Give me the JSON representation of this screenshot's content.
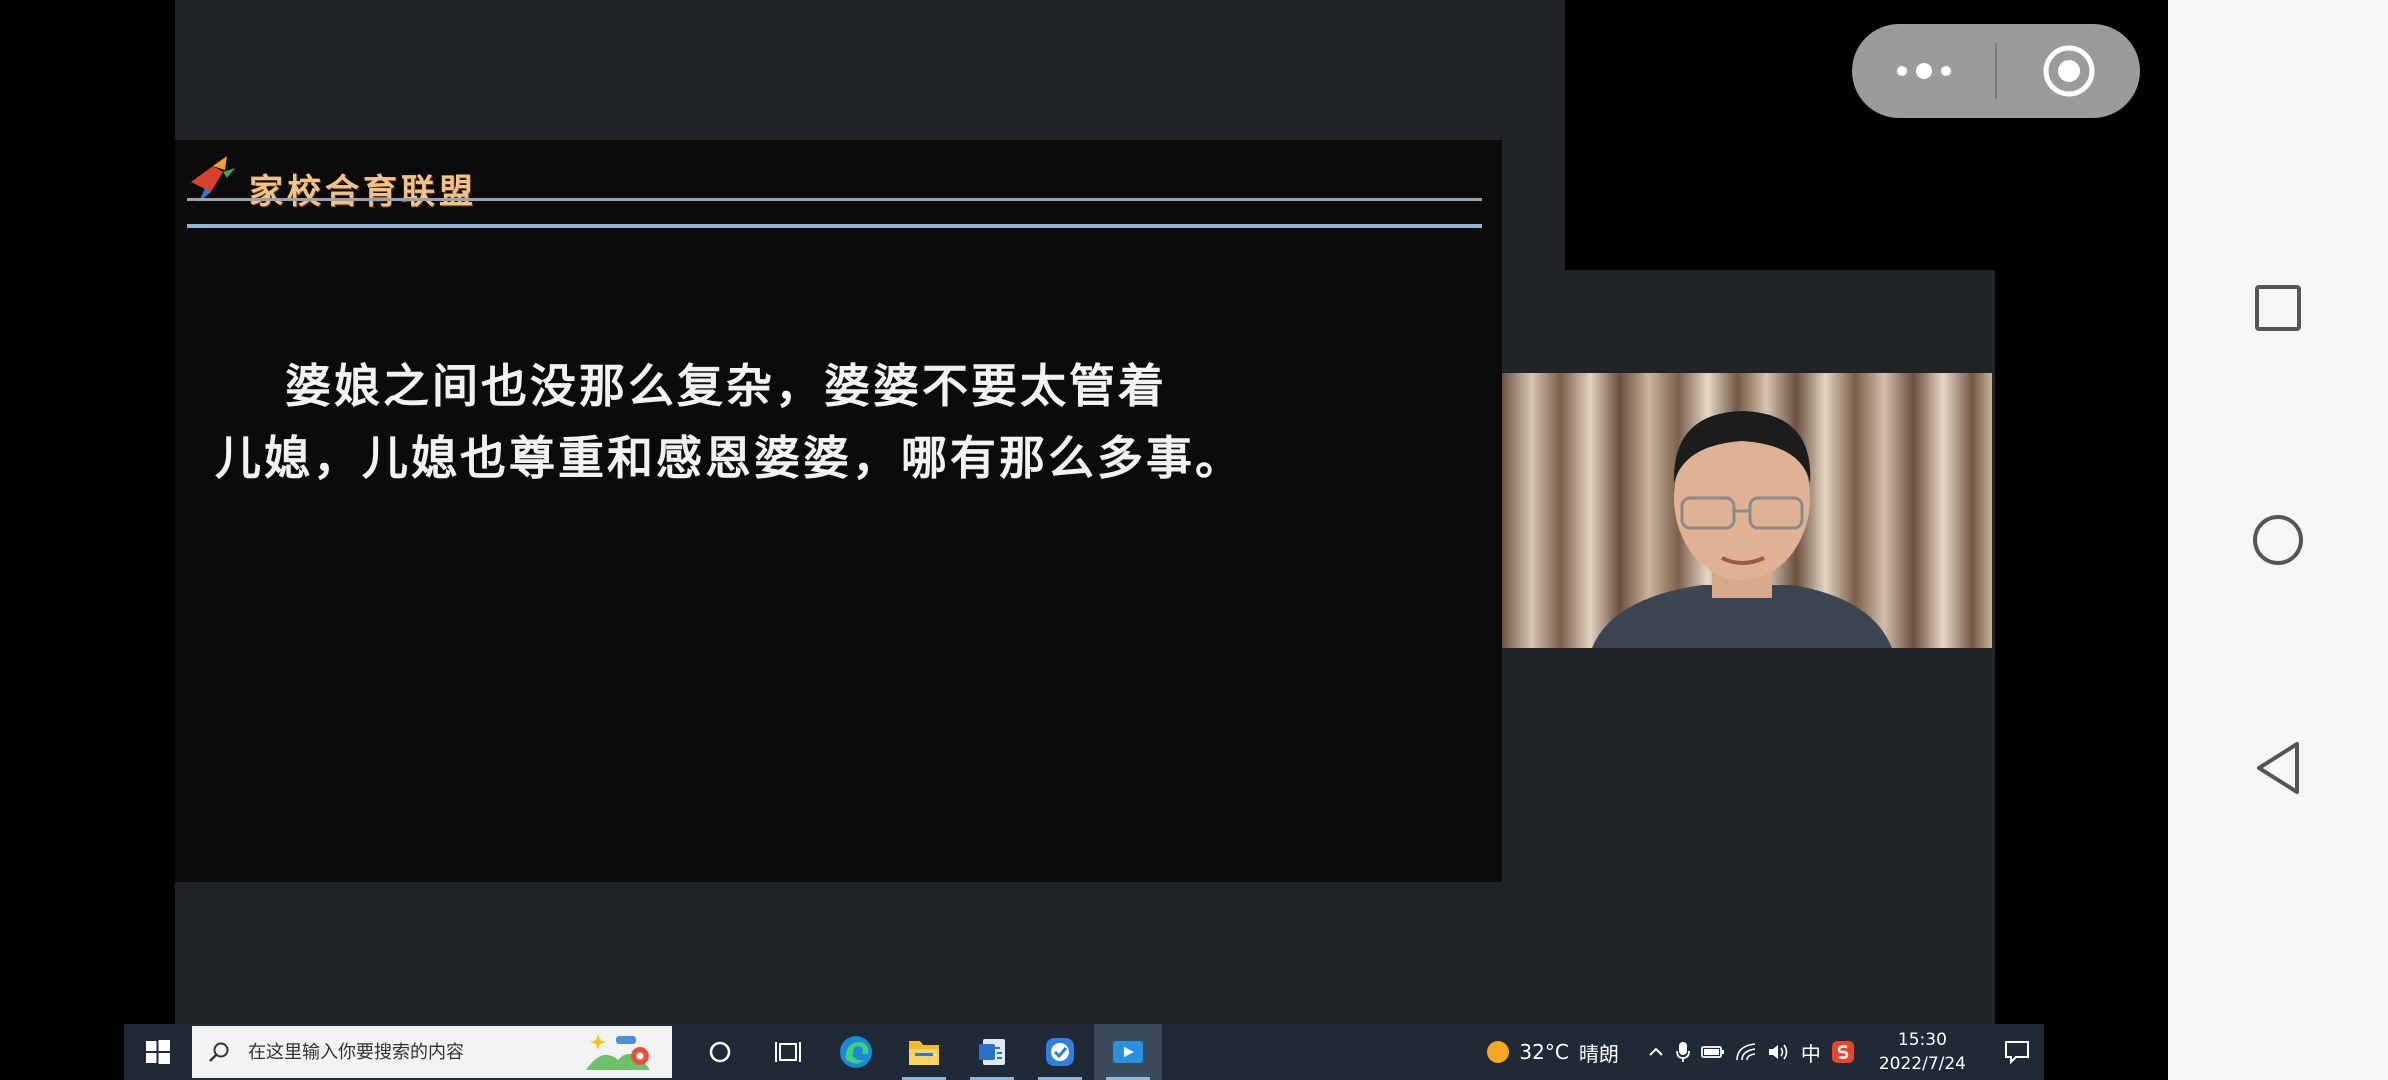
{
  "slide": {
    "brand": "家校合育联盟",
    "text_line1": "婆娘之间也没那么复杂，婆婆不要太管着",
    "text_line2": "儿媳，儿媳也尊重和感恩婆婆，哪有那么多事。"
  },
  "taskbar": {
    "search_placeholder": "在这里输入你要搜索的内容",
    "weather_temp": "32°C",
    "weather_desc": "晴朗",
    "ime": "中",
    "time": "15:30",
    "date": "2022/7/24"
  },
  "icons": {
    "start": "windows-start-icon",
    "search": "magnifier-icon",
    "cortana": "circle-icon",
    "task_view": "task-view-icon",
    "edge": "edge-browser-icon",
    "explorer": "folder-icon",
    "word_app": "document-app-icon",
    "check_app": "check-app-icon",
    "video_app": "video-app-icon",
    "notification": "notification-icon",
    "more": "more-dots-icon",
    "close": "target-close-icon",
    "recent": "square-icon",
    "home": "circle-home-icon",
    "back": "triangle-back-icon"
  },
  "colors": {
    "taskbar": "#1f2a36",
    "slide_text": "#f2f2f2",
    "brand_text": "#f0c38a",
    "rule": "#8fb6d8"
  }
}
